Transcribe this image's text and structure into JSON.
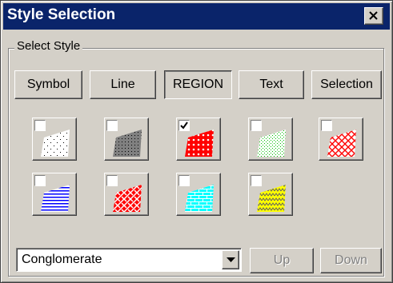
{
  "window": {
    "title": "Style Selection"
  },
  "group": {
    "label": "Select Style"
  },
  "categories": [
    {
      "label": "Symbol",
      "pressed": false
    },
    {
      "label": "Line",
      "pressed": false
    },
    {
      "label": "REGION",
      "pressed": true
    },
    {
      "label": "Text",
      "pressed": false
    },
    {
      "label": "Selection",
      "pressed": false
    }
  ],
  "styles": [
    {
      "name": "sparse-dots",
      "color": "#000000",
      "checked": false
    },
    {
      "name": "dense-dots-gray",
      "color": "#808080",
      "checked": false
    },
    {
      "name": "red-circles",
      "color": "#ff0000",
      "checked": true
    },
    {
      "name": "green-dots",
      "color": "#00c000",
      "checked": false
    },
    {
      "name": "red-crosshatch",
      "color": "#ff0000",
      "checked": false
    },
    {
      "name": "blue-horizontal-lines",
      "color": "#0000ff",
      "checked": false
    },
    {
      "name": "red-weave",
      "color": "#ff0000",
      "checked": false
    },
    {
      "name": "cyan-brick",
      "color": "#00ffff",
      "checked": false
    },
    {
      "name": "yellow-zigzag",
      "color": "#ffff00",
      "checked": false
    }
  ],
  "select": {
    "value": "Conglomerate"
  },
  "nav": {
    "up_label": "Up",
    "down_label": "Down",
    "enabled": false
  }
}
